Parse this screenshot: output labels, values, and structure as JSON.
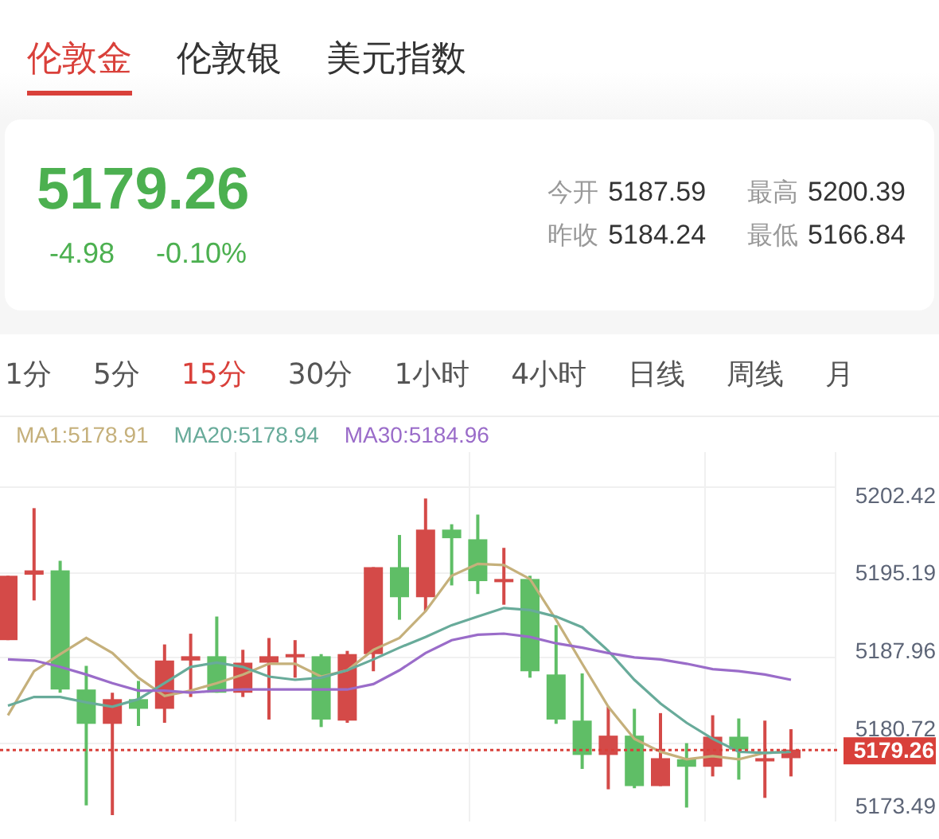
{
  "tabs": [
    {
      "label": "伦敦金",
      "selected": true
    },
    {
      "label": "伦敦银",
      "selected": false
    },
    {
      "label": "美元指数",
      "selected": false
    }
  ],
  "quote": {
    "price": "5179.26",
    "change": "-4.98",
    "change_percent": "-0.10%",
    "falling": true
  },
  "stats": [
    {
      "label": "今开",
      "value": "5187.59"
    },
    {
      "label": "最高",
      "value": "5200.39"
    },
    {
      "label": "昨收",
      "value": "5184.24"
    },
    {
      "label": "最低",
      "value": "5166.84"
    }
  ],
  "periods": [
    {
      "label": "1分",
      "selected": false
    },
    {
      "label": "5分",
      "selected": false
    },
    {
      "label": "15分",
      "selected": true
    },
    {
      "label": "30分",
      "selected": false
    },
    {
      "label": "1小时",
      "selected": false
    },
    {
      "label": "4小时",
      "selected": false
    },
    {
      "label": "日线",
      "selected": false
    },
    {
      "label": "周线",
      "selected": false
    },
    {
      "label": "月",
      "selected": false
    }
  ],
  "chart": {
    "chart_data": {
      "type": "candlestick",
      "ylim": [
        5172.6,
        5207.02
      ],
      "yticks": [
        {
          "value": 5202.42,
          "label": "5202.42"
        },
        {
          "value": 5195.19,
          "label": "5195.19"
        },
        {
          "value": 5187.96,
          "label": "5187.96"
        },
        {
          "value": 5180.72,
          "label": "5180.72"
        },
        {
          "value": 5173.49,
          "label": "5173.49"
        }
      ],
      "ref_lines": [
        {
          "axis": "y",
          "value": 5179.26,
          "label": "5179.26",
          "color": "#d9403a"
        }
      ],
      "series": [
        {
          "name": "MA1:5178.91",
          "type": "line",
          "color": "#c5b07b",
          "values": [
            5182.5,
            5186.6,
            5188.2,
            5189.7,
            5188.3,
            5186.0,
            5184.3,
            5184.8,
            5185.5,
            5186.3,
            5187.3,
            5187.3,
            5186.1,
            5186.7,
            5188.6,
            5189.7,
            5192.2,
            5195.5,
            5196.6,
            5196.5,
            5195.2,
            5191.4,
            5187.3,
            5183.3,
            5180.3,
            5179.1,
            5178.4,
            5178.7,
            5178.4,
            5179.0,
            5179.1
          ]
        },
        {
          "name": "MA20:5178.94",
          "type": "line",
          "color": "#68ab9a",
          "values": [
            5183.4,
            5184.2,
            5184.2,
            5183.7,
            5183.3,
            5184.0,
            5185.5,
            5187.0,
            5187.4,
            5187.0,
            5186.1,
            5185.8,
            5186.0,
            5186.7,
            5187.7,
            5188.8,
            5189.8,
            5190.9,
            5191.7,
            5192.5,
            5192.3,
            5191.7,
            5190.7,
            5188.5,
            5185.8,
            5183.6,
            5181.8,
            5180.3,
            5179.1,
            5179.0,
            5179.1
          ]
        },
        {
          "name": "MA30:5184.96",
          "type": "line",
          "color": "#9a6cc9",
          "values": [
            5187.7,
            5187.6,
            5187.0,
            5186.3,
            5185.5,
            5184.8,
            5184.8,
            5184.6,
            5184.8,
            5184.9,
            5184.9,
            5184.9,
            5184.9,
            5184.9,
            5185.4,
            5186.7,
            5188.3,
            5189.5,
            5190.0,
            5190.1,
            5189.8,
            5189.2,
            5188.8,
            5188.3,
            5187.9,
            5187.7,
            5187.3,
            5186.8,
            5186.6,
            5186.3,
            5185.8
          ]
        }
      ],
      "ohlc": [
        [
          5189.5,
          5195.5,
          5189.5,
          5195.5
        ],
        [
          5195.6,
          5201.8,
          5193.2,
          5196.0
        ],
        [
          5196.0,
          5196.9,
          5184.6,
          5184.9
        ],
        [
          5184.9,
          5187.1,
          5174.1,
          5181.7
        ],
        [
          5181.7,
          5184.6,
          5173.2,
          5184.0
        ],
        [
          5184.0,
          5185.7,
          5181.5,
          5183.1
        ],
        [
          5183.1,
          5189.1,
          5181.8,
          5187.6
        ],
        [
          5187.6,
          5190.1,
          5184.2,
          5188.0
        ],
        [
          5188.0,
          5191.7,
          5184.6,
          5184.6
        ],
        [
          5184.6,
          5188.6,
          5184.2,
          5187.4
        ],
        [
          5187.4,
          5189.7,
          5182.1,
          5188.0
        ],
        [
          5187.9,
          5189.5,
          5186.0,
          5188.2
        ],
        [
          5188.0,
          5188.2,
          5181.4,
          5182.1
        ],
        [
          5182.0,
          5188.5,
          5181.8,
          5188.2
        ],
        [
          5188.2,
          5196.3,
          5186.6,
          5196.3
        ],
        [
          5196.3,
          5199.3,
          5191.4,
          5193.5
        ],
        [
          5193.5,
          5202.7,
          5192.2,
          5199.8
        ],
        [
          5199.8,
          5200.3,
          5194.6,
          5199.0
        ],
        [
          5198.9,
          5201.2,
          5193.8,
          5195.0
        ],
        [
          5194.9,
          5198.1,
          5192.8,
          5195.2
        ],
        [
          5195.2,
          5195.5,
          5186.0,
          5186.6
        ],
        [
          5186.3,
          5190.9,
          5181.7,
          5182.1
        ],
        [
          5182.0,
          5186.4,
          5177.5,
          5178.8
        ],
        [
          5178.8,
          5183.3,
          5175.6,
          5180.6
        ],
        [
          5180.6,
          5183.1,
          5175.7,
          5175.9
        ],
        [
          5175.9,
          5182.7,
          5175.9,
          5178.5
        ],
        [
          5178.4,
          5179.9,
          5173.9,
          5177.7
        ],
        [
          5177.7,
          5182.5,
          5176.8,
          5180.5
        ],
        [
          5180.5,
          5182.2,
          5176.5,
          5179.3
        ],
        [
          5178.2,
          5182.0,
          5174.8,
          5178.5
        ],
        [
          5178.5,
          5181.2,
          5176.8,
          5179.3
        ]
      ]
    }
  }
}
